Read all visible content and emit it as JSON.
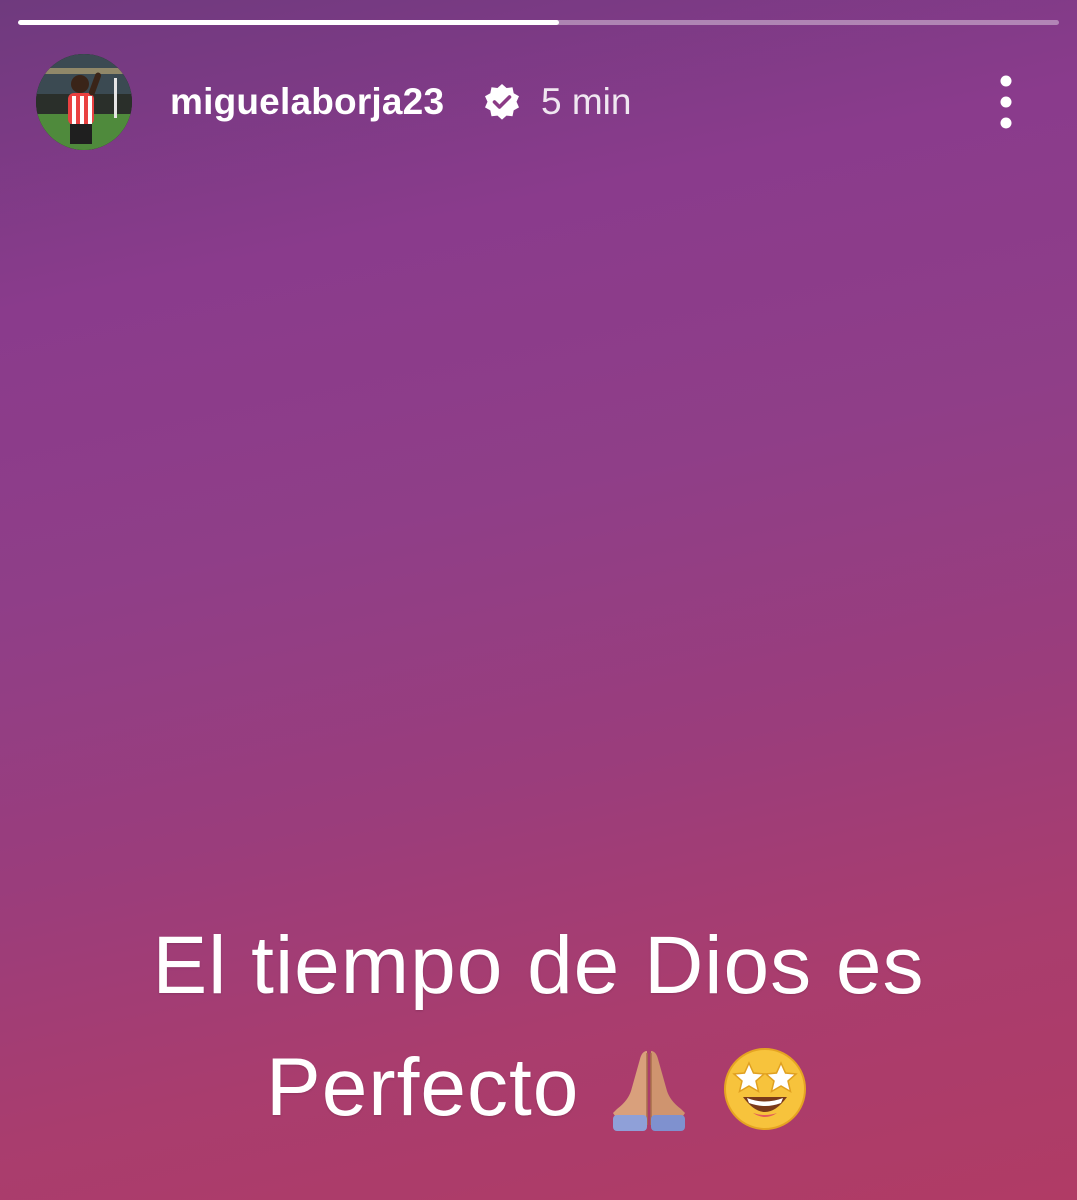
{
  "story": {
    "progress_fraction": 0.52
  },
  "header": {
    "username": "miguelaborja23",
    "verified_icon": "verified-badge-icon",
    "time_ago": "5 min",
    "menu_icon": "more-vertical-icon"
  },
  "caption": {
    "line1": "El tiempo de Dios es",
    "line2_text": "Perfecto",
    "emojis": [
      "folded-hands-icon",
      "star-struck-icon"
    ]
  },
  "colors": {
    "gradient_top": "#6f3a7e",
    "gradient_mid": "#8f3e88",
    "gradient_bottom": "#b03b65",
    "text": "#ffffff"
  }
}
